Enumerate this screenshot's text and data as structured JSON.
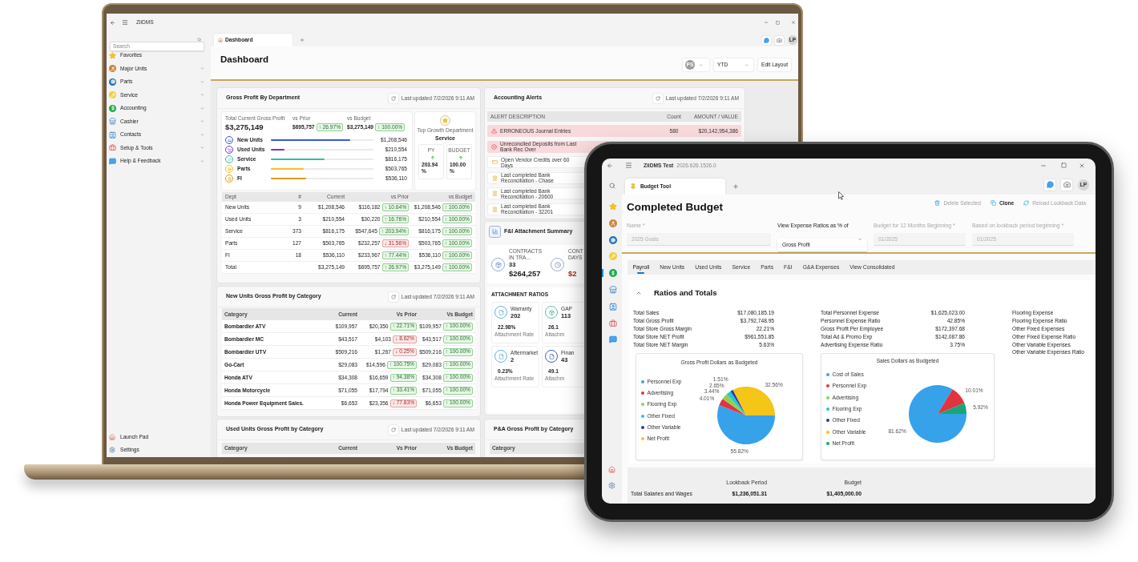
{
  "laptop": {
    "app_name": "ZiiDMS",
    "sidebar": {
      "search": {
        "placeholder": "Search"
      },
      "items": [
        {
          "label": "Favorites",
          "expandable": false
        },
        {
          "label": "Major Units",
          "expandable": true
        },
        {
          "label": "Parts",
          "expandable": true
        },
        {
          "label": "Service",
          "expandable": true
        },
        {
          "label": "Accounting",
          "expandable": true
        },
        {
          "label": "Cashier",
          "expandable": true
        },
        {
          "label": "Contacts",
          "expandable": true
        },
        {
          "label": "Setup & Tools",
          "expandable": true
        },
        {
          "label": "Help & Feedback",
          "expandable": true
        }
      ],
      "footer_items": [
        {
          "label": "Launch Pad"
        },
        {
          "label": "Settings"
        }
      ]
    },
    "tabs": [
      {
        "label": "Dashboard",
        "selected": true
      }
    ],
    "user_initials": "LP",
    "header": {
      "title": "Dashboard",
      "user_filter": "PS",
      "period": "YTD",
      "edit_button": "Edit Layout"
    },
    "gross_profit": {
      "title": "Gross Profit By Department",
      "updated": "Last updated 7/2/2026 9:11 AM",
      "total": {
        "label": "Total Current Gross Profit",
        "value": "$3,275,149"
      },
      "comparisons": [
        {
          "label": "vs Prior",
          "value": "$695,757",
          "change": "↑ 26.97%",
          "positive": true
        },
        {
          "label": "vs Budget",
          "value": "$3,275,149",
          "change": "↑ 100.00%",
          "positive": true
        }
      ],
      "departments": [
        {
          "name": "New Units",
          "level": 0.77,
          "color": "#3a57d6",
          "value": "$1,208,546"
        },
        {
          "name": "Used Units",
          "level": 0.13,
          "color": "#7b2fd8",
          "value": "$210,554"
        },
        {
          "name": "Service",
          "level": 0.52,
          "color": "#2cbfa5",
          "value": "$816,175"
        },
        {
          "name": "Parts",
          "level": 0.32,
          "color": "#f0c02c",
          "value": "$503,765"
        },
        {
          "name": "FI",
          "level": 0.34,
          "color": "#e09a1a",
          "value": "$536,110"
        }
      ],
      "top_growth": {
        "label": "Top Growth Department",
        "department": "Service",
        "metrics": [
          {
            "label": "PY",
            "positive": true,
            "value": "203.94 %"
          },
          {
            "label": "BUDGET",
            "positive": true,
            "value": "100.00 %"
          }
        ]
      },
      "table": {
        "columns": [
          "Dept",
          "#",
          "Current",
          "vs Prior",
          "vs Budget"
        ],
        "rows": [
          {
            "dept": "New Units",
            "count": "9",
            "current": "$1,208,546",
            "prior": {
              "value": "$116,182",
              "change": "↑ 10.64%",
              "positive": true
            },
            "budget": {
              "value": "$1,208,546",
              "change": "↑ 100.00%",
              "positive": true
            }
          },
          {
            "dept": "Used Units",
            "count": "3",
            "current": "$210,554",
            "prior": {
              "value": "$30,220",
              "change": "↑ 16.76%",
              "positive": true
            },
            "budget": {
              "value": "$210,554",
              "change": "↑ 100.00%",
              "positive": true
            }
          },
          {
            "dept": "Service",
            "count": "373",
            "current": "$816,175",
            "prior": {
              "value": "$547,645",
              "change": "↑ 203.94%",
              "positive": true
            },
            "budget": {
              "value": "$816,175",
              "change": "↑ 100.00%",
              "positive": true
            }
          },
          {
            "dept": "Parts",
            "count": "127",
            "current": "$503,765",
            "prior": {
              "value": "$232,257",
              "change": "↓ 31.56%",
              "positive": false
            },
            "budget": {
              "value": "$503,765",
              "change": "↑ 100.00%",
              "positive": true
            }
          },
          {
            "dept": "FI",
            "count": "18",
            "current": "$536,110",
            "prior": {
              "value": "$233,967",
              "change": "↑ 77.44%",
              "positive": true
            },
            "budget": {
              "value": "$536,110",
              "change": "↑ 100.00%",
              "positive": true
            }
          },
          {
            "dept": "Total",
            "current": "$3,275,149",
            "prior": {
              "value": "$695,757",
              "change": "↑ 26.97%",
              "positive": true
            },
            "budget": {
              "value": "$3,275,149",
              "change": "↑ 100.00%",
              "positive": true
            }
          }
        ]
      }
    },
    "new_units": {
      "title": "New Units Gross Profit by Category",
      "updated": "Last updated 7/2/2026 9:11 AM",
      "columns": [
        "Category",
        "Current",
        "Vs Prior",
        "Vs Budget"
      ],
      "rows": [
        {
          "category": "Bombardier ATV",
          "current": "$109,957",
          "prior": {
            "value": "$20,350",
            "change": "↑ 22.71%",
            "positive": true
          },
          "budget": {
            "value": "$109,957",
            "change": "↑ 100.00%",
            "positive": true
          }
        },
        {
          "category": "Bombardier MC",
          "current": "$43,517",
          "prior": {
            "value": "$4,103",
            "change": "↓ 8.62%",
            "positive": false
          },
          "budget": {
            "value": "$43,517",
            "change": "↑ 100.00%",
            "positive": true
          }
        },
        {
          "category": "Bombardier UTV",
          "current": "$509,216",
          "prior": {
            "value": "$1,267",
            "change": "↓ 0.25%",
            "positive": false
          },
          "budget": {
            "value": "$509,216",
            "change": "↑ 100.00%",
            "positive": true
          }
        },
        {
          "category": "Go-Cart",
          "current": "$29,083",
          "prior": {
            "value": "$14,596",
            "change": "↑ 100.75%",
            "positive": true
          },
          "budget": {
            "value": "$29,083",
            "change": "↑ 100.00%",
            "positive": true
          }
        },
        {
          "category": "Honda ATV",
          "current": "$34,308",
          "prior": {
            "value": "$16,659",
            "change": "↑ 94.38%",
            "positive": true
          },
          "budget": {
            "value": "$34,308",
            "change": "↑ 100.00%",
            "positive": true
          }
        },
        {
          "category": "Honda Motorcycle",
          "current": "$71,055",
          "prior": {
            "value": "$17,794",
            "change": "↑ 33.41%",
            "positive": true
          },
          "budget": {
            "value": "$71,055",
            "change": "↑ 100.00%",
            "positive": true
          }
        },
        {
          "category": "Honda Power Equipment Sales.",
          "current": "$6,653",
          "prior": {
            "value": "$23,356",
            "change": "↓ 77.83%",
            "positive": false
          },
          "budget": {
            "value": "$6,653",
            "change": "↑ 100.00%",
            "positive": true
          }
        }
      ]
    },
    "used_units": {
      "title": "Used Units Gross Profit by Category",
      "updated": "Last updated 7/2/2026 9:11 AM",
      "columns": [
        "Category",
        "Current",
        "Vs Prior",
        "Vs Budget"
      ]
    },
    "accounting_alerts": {
      "title": "Accounting Alerts",
      "updated": "Last updated 7/2/2026 9:11 AM",
      "columns": [
        "ALERT DESCRIPTION",
        "Count",
        "AMOUNT / VALUE"
      ],
      "rows": [
        {
          "kind": "error",
          "description": "ERRONEOUS Journal Entries",
          "count": "580",
          "amount": "$20,142,954,386"
        },
        {
          "kind": "critical",
          "description": "Unreconciled Deposits from Last Bank Rec Over"
        },
        {
          "kind": "credit",
          "description": "Open Vendor Credits over 60 Days"
        },
        {
          "kind": "bank",
          "description": "Last completed Bank Reconciliation - Chase"
        },
        {
          "kind": "bank",
          "description": "Last completed Bank Reconciliation - 20600"
        },
        {
          "kind": "bank",
          "description": "Last completed Bank Reconciliation - 32201"
        }
      ]
    },
    "fi_summary": {
      "title": "F&I Attachment Summary",
      "contracts": [
        {
          "label": "CONTRACTS IN TRA...",
          "count": "33",
          "amount": "$264,257",
          "alert": false
        },
        {
          "label": "CONT",
          "sublabel": "DAYS",
          "amount": "$2",
          "alert": true
        }
      ],
      "ratios": {
        "title": "ATTACHMENT RATIOS",
        "items": [
          {
            "name": "Warranty",
            "count": "202",
            "rate": "22.98%",
            "rate_label": "Attachment Rate"
          },
          {
            "name": "GAP",
            "count": "113",
            "rate": "26.1",
            "rate_label": "Attachm"
          },
          {
            "name": "Aftermarket",
            "count": "2",
            "rate": "0.23%",
            "rate_label": "Attachment Rate"
          },
          {
            "name": "Finan",
            "count": "43",
            "rate": "49.1",
            "rate_label": "Attachm"
          }
        ]
      }
    },
    "pa_gross_profit": {
      "title": "P&A Gross Profit by Category",
      "columns": [
        "Category"
      ]
    }
  },
  "tablet": {
    "app_name": "ZiiDMS Test",
    "version": "2026.626.1526.0",
    "rail_items": [
      {
        "selected": false
      },
      {
        "selected": false
      },
      {
        "selected": false
      },
      {
        "selected": false
      },
      {
        "selected": true
      },
      {
        "selected": false
      },
      {
        "selected": false
      },
      {
        "selected": false
      },
      {
        "selected": false
      }
    ],
    "tabs": [
      {
        "label": "Budget Tool",
        "selected": true
      }
    ],
    "user_initials": "LP",
    "title": "Completed Budget",
    "actions": [
      {
        "label": "Delete Selected",
        "disabled": true
      },
      {
        "label": "Clone",
        "disabled": false
      },
      {
        "label": "Reload Lookback Data",
        "disabled": true
      }
    ],
    "fields": [
      {
        "kind": "text",
        "label": "Name *",
        "value": "2025 Goals",
        "disabled": true
      },
      {
        "kind": "select",
        "label": "View Expense Ratios as % of",
        "value": "Gross Profit",
        "disabled": false
      },
      {
        "kind": "text",
        "label": "Budget for 12 Months Beginning *",
        "value": "01/2025",
        "disabled": true
      },
      {
        "kind": "text",
        "label": "Based on lookback period beginning *",
        "value": "01/2025",
        "disabled": true
      }
    ],
    "section_tabs": [
      {
        "label": "Payroll",
        "selected": true
      },
      {
        "label": "New Units",
        "selected": false
      },
      {
        "label": "Used Units",
        "selected": false
      },
      {
        "label": "Service",
        "selected": false
      },
      {
        "label": "Parts",
        "selected": false
      },
      {
        "label": "F&I",
        "selected": false
      },
      {
        "label": "G&A Expenses",
        "selected": false
      },
      {
        "label": "View Consolidated",
        "selected": false
      }
    ],
    "ratios_section": {
      "title": "Ratios and Totals",
      "expanded": true,
      "stat_columns": [
        [
          {
            "label": "Total Sales",
            "value": "$17,080,185.19"
          },
          {
            "label": "Total Gross Profit",
            "value": "$3,792,748.95"
          },
          {
            "label": "Total Store Gross Margin",
            "value": "22.21%"
          },
          {
            "label": "Total Store NET Profit",
            "value": "$961,551.85"
          },
          {
            "label": "Total Store NET Margin",
            "value": "5.63%"
          }
        ],
        [
          {
            "label": "Total Personnel Expense",
            "value": "$1,625,023.00"
          },
          {
            "label": "Personnel Expense Ratio",
            "value": "42.85%"
          },
          {
            "label": "Gross Profit Per Employee",
            "value": "$172,397.68"
          },
          {
            "label": "Total Ad & Promo Exp",
            "value": "$142,087.86"
          },
          {
            "label": "Advertising Expense Ratio",
            "value": "3.75%"
          }
        ],
        [
          {
            "label": "Flooring Expense"
          },
          {
            "label": "Flooring Expense Ratio"
          },
          {
            "label": "Other Fixed Expenses"
          },
          {
            "label": "Other Fixed Expense Ratio"
          },
          {
            "label": "Other Variable Expenses"
          },
          {
            "label": "Other Variable Expenses Ratio"
          }
        ]
      ],
      "charts": [
        {
          "chart_data": {
            "type": "pie",
            "title": "Gross Profit Dollars as Budgeted",
            "legend": "left",
            "categories": [
              "Personnel Exp",
              "Advertising",
              "Flooring Exp",
              "Other Fixed",
              "Other Variable",
              "Net Profit"
            ],
            "values": [
              55.82,
              4.01,
              3.44,
              2.65,
              1.51,
              32.56
            ],
            "colors": [
              "#35a2ea",
              "#e2333f",
              "#8fd14f",
              "#22c7d3",
              "#2b3a9b",
              "#f5c518"
            ],
            "value_labels": [
              "55.82%",
              "4.01%",
              "3.44%",
              "2.65%",
              "1.51%",
              "32.56%"
            ]
          }
        },
        {
          "chart_data": {
            "type": "pie",
            "title": "Sales Dollars as Budgeted",
            "legend": "left",
            "categories": [
              "Cost of Sales",
              "Personnel Exp",
              "Advertising",
              "Flooring Exp",
              "Other Fixed",
              "Other Variable",
              "Net Profit"
            ],
            "values": [
              81.62,
              10.01,
              null,
              null,
              null,
              null,
              5.92
            ],
            "colors": [
              "#35a2ea",
              "#e2333f",
              "#8fd14f",
              "#22c7d3",
              "#2b3a9b",
              "#f5c518",
              "#18a57a"
            ],
            "value_labels": [
              "81.62%",
              "10.01%",
              null,
              null,
              null,
              null,
              "5.92%"
            ]
          }
        }
      ]
    },
    "payroll": {
      "columns": [
        "Lookback Period",
        "Budget"
      ],
      "rows": [
        {
          "label": "Total Salaries and Wages",
          "values": [
            "$1,236,051.31",
            "$1,405,000.00"
          ]
        }
      ]
    }
  }
}
